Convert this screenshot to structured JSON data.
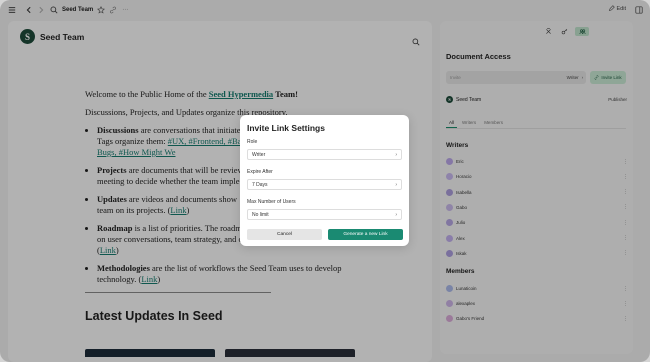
{
  "topbar": {
    "title": "Seed Team",
    "edit_label": "Edit",
    "more": "···"
  },
  "doc": {
    "title": "Seed Team",
    "logo_letter": "S",
    "intro_pre": "Welcome to the Public Home of the ",
    "intro_link": "Seed Hypermedia",
    "intro_post": " Team!",
    "para2": "Discussions, Projects, and Updates organize this repository.",
    "bullets": [
      {
        "term": "Discussions",
        "text": " are conversations that initiate",
        "line2": "Tags organize them: ",
        "tags": "#UX, #Frontend, #Ba",
        "line3": "Bugs, #How Might We"
      },
      {
        "term": "Projects",
        "text": " are documents that will be review",
        "line2": "meeting to decide whether the team imple"
      },
      {
        "term": "Updates",
        "text": " are videos and documents show",
        "line2": "team on its projects. (",
        "link": "Link",
        "post": ")"
      },
      {
        "term": "Roadmap",
        "text": " is a list of priorities. The roadm",
        "line2": "on user conversations, team strategy, and c",
        "line3_link": "Link",
        "line3_post": ")"
      },
      {
        "term": "Methodologies",
        "text": " are the list of workflows the Seed Team uses to develop",
        "line2": "technology. (",
        "link": "Link",
        "post": ")"
      }
    ],
    "latest_heading": "Latest Updates In Seed"
  },
  "dialog": {
    "title": "Invite Link Settings",
    "role_label": "Role",
    "role_value": "Writer",
    "expire_label": "Expire After",
    "expire_value": "7 Days",
    "max_label": "Max Number of Users",
    "max_value": "No limit",
    "cancel_label": "Cancel",
    "generate_label": "Generate a new Link"
  },
  "side": {
    "title": "Document Access",
    "invite_placeholder": "Invite",
    "invite_role": "Writer",
    "invite_button": "Invite Link",
    "owner_name": "Seed Team",
    "owner_role": "Publisher",
    "tabs": [
      "All",
      "Writers",
      "Members"
    ],
    "writers_title": "Writers",
    "writers": [
      "Eric",
      "Horacio",
      "Isabella",
      "Gabo",
      "Julio",
      "Alex",
      "Iskak"
    ],
    "members_title": "Members",
    "members": [
      "Lunaticoin",
      "alexaplex",
      "Gabo's Friend"
    ]
  },
  "colors": {
    "accent": "#1a8a72",
    "link": "#157a6e",
    "logo_bg": "#1e4a3a",
    "invite_btn_bg": "#c7e6d1"
  }
}
